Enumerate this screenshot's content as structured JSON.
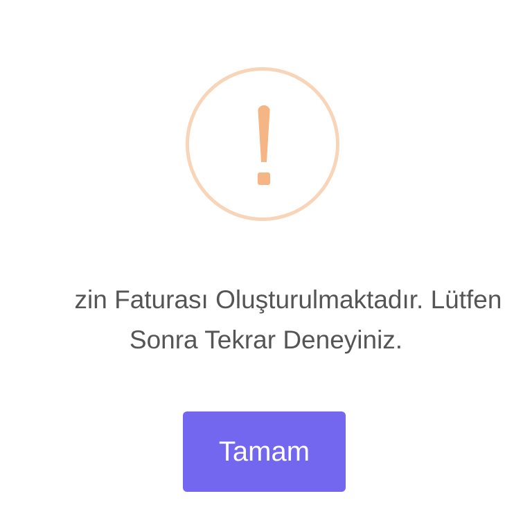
{
  "alert": {
    "icon": "warning-exclamation-icon",
    "message_line_1": "zin Faturası Oluşturulmaktadır. Lütfen",
    "message_line_2": "Sonra Tekrar Deneyiniz.",
    "confirm_label": "Tamam"
  },
  "colors": {
    "icon_ring": "#f8d5b8",
    "icon_mark": "#f5b584",
    "text": "#555555",
    "button": "#7367f0",
    "button_text": "#ffffff"
  }
}
